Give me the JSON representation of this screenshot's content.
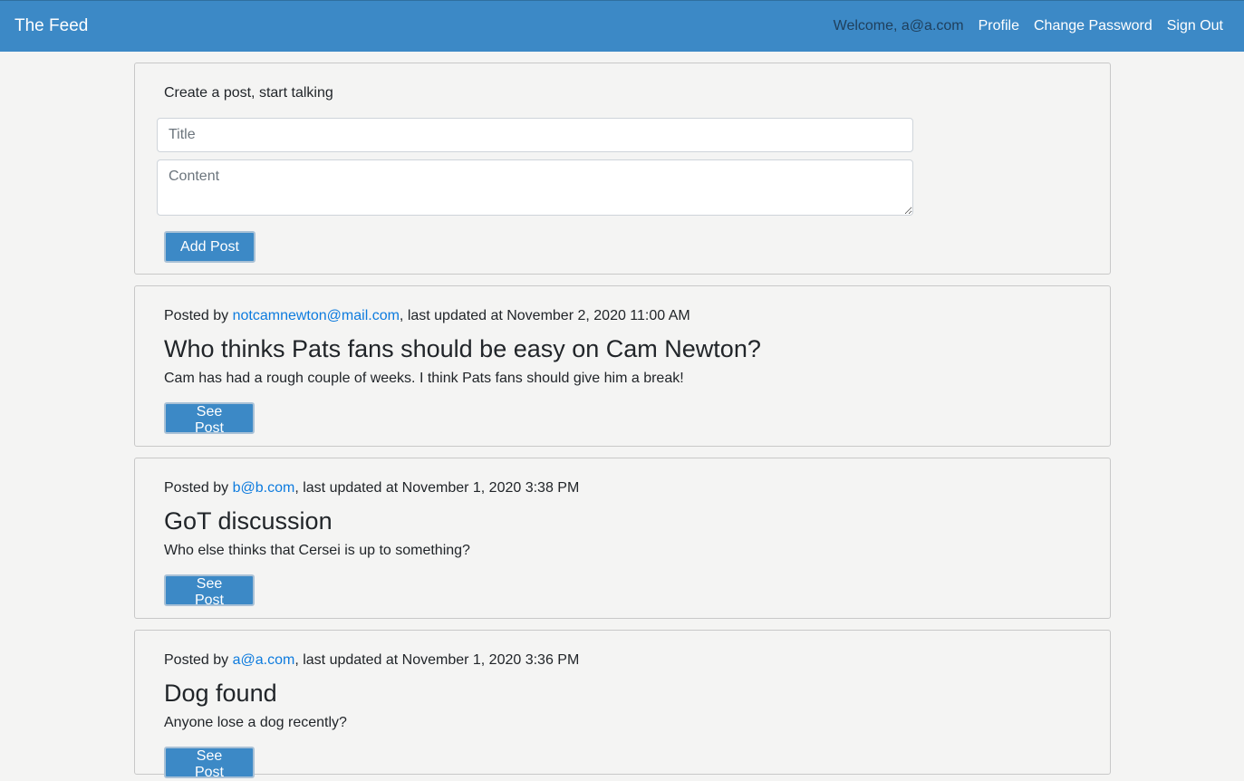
{
  "navbar": {
    "brand": "The Feed",
    "welcome": "Welcome, a@a.com",
    "links": [
      "Profile",
      "Change Password",
      "Sign Out"
    ]
  },
  "create_post": {
    "heading": "Create a post, start talking",
    "title_placeholder": "Title",
    "content_placeholder": "Content",
    "button_label": "Add Post"
  },
  "posts": [
    {
      "posted_by_prefix": "Posted by ",
      "author": "notcamnewton@mail.com",
      "updated_text": ", last updated at November 2, 2020 11:00 AM",
      "title": "Who thinks Pats fans should be easy on Cam Newton?",
      "body": "Cam has had a rough couple of weeks. I think Pats fans should give him a break!",
      "button_label": "See Post"
    },
    {
      "posted_by_prefix": "Posted by ",
      "author": "b@b.com",
      "updated_text": ", last updated at November 1, 2020 3:38 PM",
      "title": "GoT discussion",
      "body": "Who else thinks that Cersei is up to something?",
      "button_label": "See Post"
    },
    {
      "posted_by_prefix": "Posted by ",
      "author": "a@a.com",
      "updated_text": ", last updated at November 1, 2020 3:36 PM",
      "title": "Dog found",
      "body": "Anyone lose a dog recently?",
      "button_label": "See Post"
    }
  ],
  "colors": {
    "navbar": "#3c89c6",
    "button": "#3c89c6",
    "link": "#0d7bde",
    "background": "#f4f4f3"
  }
}
